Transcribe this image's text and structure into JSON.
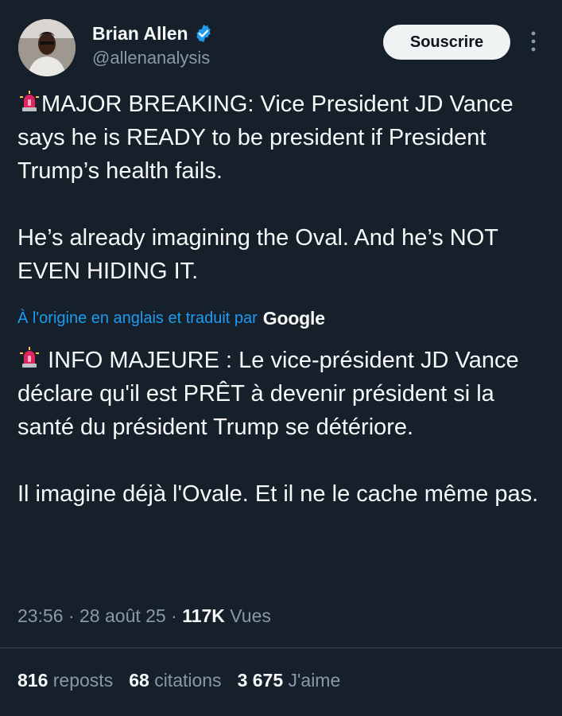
{
  "author": {
    "name": "Brian Allen",
    "handle": "@allenanalysis",
    "verified_color": "#1d9bf0"
  },
  "actions": {
    "subscribe_label": "Souscrire",
    "more_icon": "more-vertical-icon"
  },
  "original": {
    "line1": "MAJOR BREAKING: Vice President JD Vance says he is READY to be president if President Trump’s health fails.",
    "line2": "He’s already imagining the Oval. And he’s NOT EVEN HIDING IT."
  },
  "translation_notice": {
    "text": "À l'origine en anglais et traduit par",
    "provider": "Google"
  },
  "translation": {
    "line1": "INFO MAJEURE : Le vice-président JD Vance déclare qu'il est PRÊT à devenir président si la santé du président Trump se détériore.",
    "line2": "Il imagine déjà l'Ovale. Et il ne le cache même pas."
  },
  "meta": {
    "time": "23:56",
    "sep1": " · ",
    "date": "28 août 25",
    "sep2": " · ",
    "views_count": "117K",
    "views_label": "Vues"
  },
  "stats": {
    "reposts_count": "816",
    "reposts_label": "reposts",
    "quotes_count": "68",
    "quotes_label": "citations",
    "likes_count": "3 675",
    "likes_label": "J'aime"
  },
  "colors": {
    "background": "#15202b",
    "text": "#f7f9f9",
    "muted": "#8b98a5",
    "link": "#1d9bf0",
    "alarm": "#e0245e"
  }
}
